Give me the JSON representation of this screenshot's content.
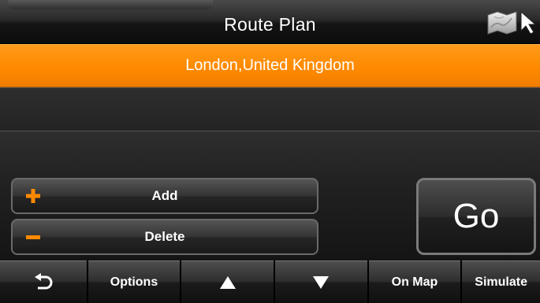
{
  "header": {
    "title": "Route Plan",
    "map_icon": "map-with-cursor-icon"
  },
  "route": {
    "items": [
      {
        "label": "London,United Kingdom",
        "selected": true
      },
      {
        "label": "",
        "selected": false
      },
      {
        "label": "",
        "selected": false
      }
    ]
  },
  "actions": {
    "add_label": "Add",
    "delete_label": "Delete",
    "go_label": "Go",
    "add_icon": "plus-icon",
    "delete_icon": "minus-icon"
  },
  "toolbar": {
    "back_icon": "back-arrow-icon",
    "options_label": "Options",
    "up_icon": "triangle-up-icon",
    "down_icon": "triangle-down-icon",
    "onmap_label": "On Map",
    "simulate_label": "Simulate"
  },
  "colors": {
    "accent": "#ff8a00",
    "background": "#000000",
    "text": "#ffffff"
  }
}
